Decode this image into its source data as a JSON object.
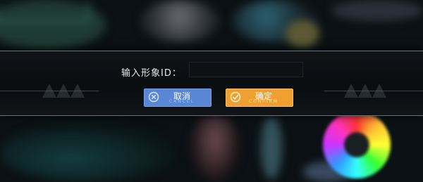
{
  "dialog": {
    "label": "输入形象ID：",
    "input_value": "",
    "input_placeholder": ""
  },
  "buttons": {
    "cancel_label": "取消",
    "cancel_sub": "CANCEL",
    "confirm_label": "确定",
    "confirm_sub": "CONFIRM"
  },
  "colors": {
    "cancel": "#5a86d6",
    "confirm": "#f0a030"
  },
  "icons": {
    "cancel": "x-circle-icon",
    "confirm": "check-circle-icon"
  }
}
